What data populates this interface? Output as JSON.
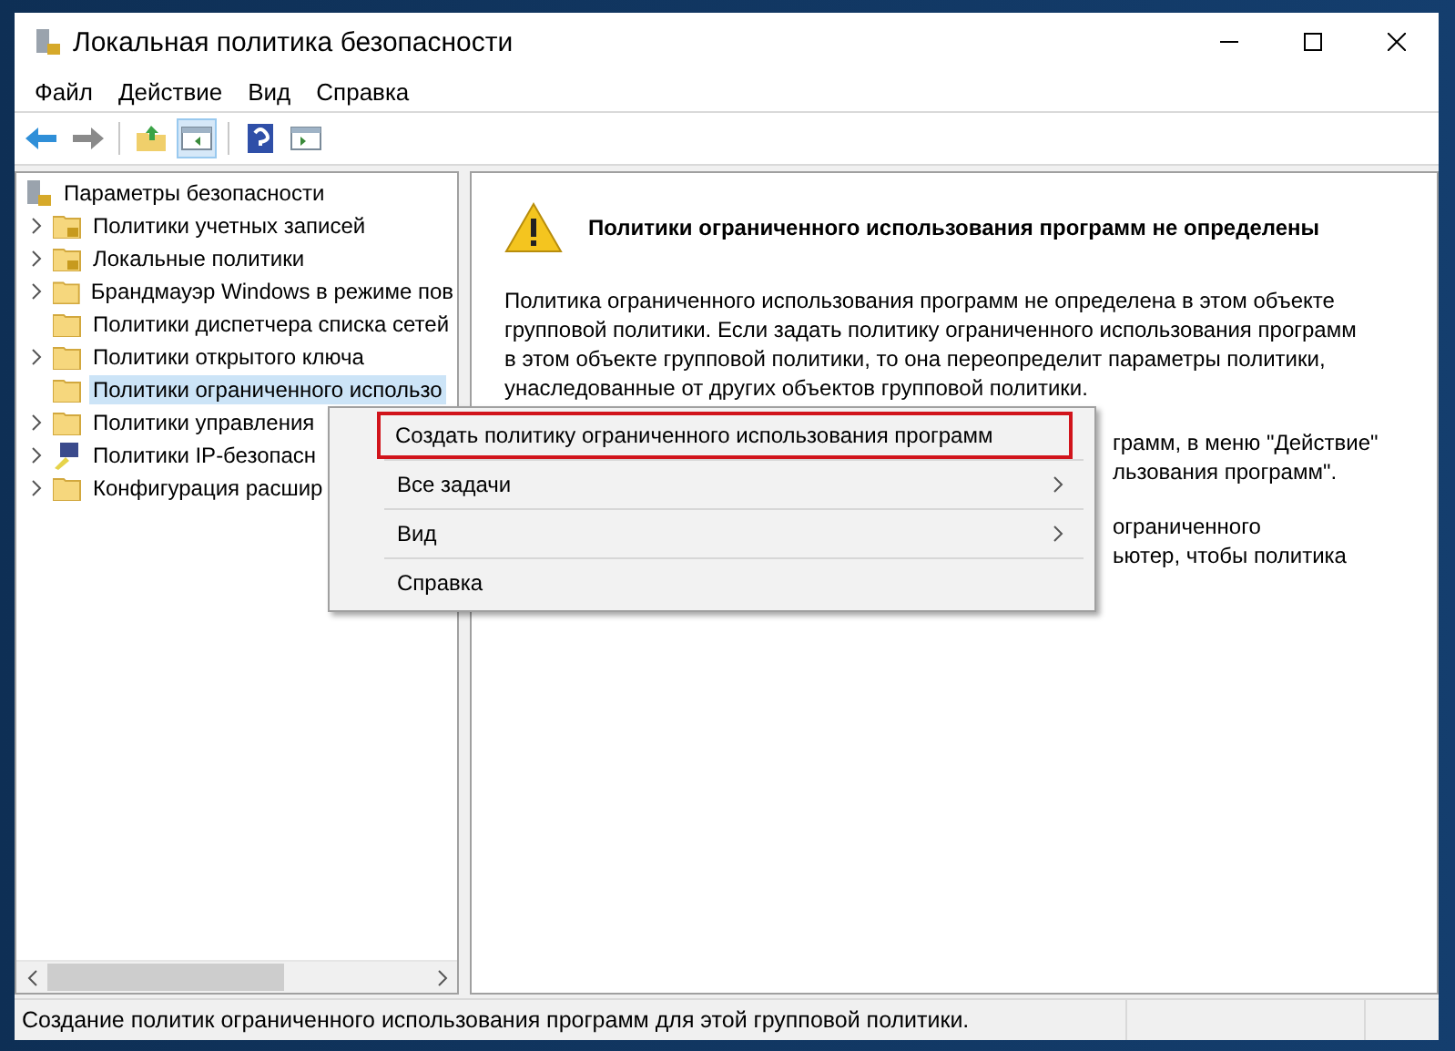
{
  "window": {
    "title": "Локальная политика безопасности"
  },
  "menu_bar": [
    "Файл",
    "Действие",
    "Вид",
    "Справка"
  ],
  "toolbar": [
    {
      "kind": "back",
      "disabled": false
    },
    {
      "kind": "forward",
      "disabled": true
    },
    {
      "kind": "separator"
    },
    {
      "kind": "up"
    },
    {
      "kind": "tree",
      "selected": true
    },
    {
      "kind": "separator"
    },
    {
      "kind": "help"
    },
    {
      "kind": "panel",
      "selected": false
    }
  ],
  "tree": {
    "root": {
      "label": "Параметры безопасности",
      "kind": "server"
    },
    "children": [
      {
        "label": "Политики учетных записей",
        "kind": "locked-folder",
        "expandable": true,
        "selected": false
      },
      {
        "label": "Локальные политики",
        "kind": "locked-folder",
        "expandable": true,
        "selected": false
      },
      {
        "label": "Брандмауэр Windows в режиме пов",
        "kind": "folder",
        "expandable": true,
        "selected": false
      },
      {
        "label": "Политики диспетчера списка сетей",
        "kind": "folder",
        "expandable": false,
        "selected": false
      },
      {
        "label": "Политики открытого ключа",
        "kind": "folder",
        "expandable": true,
        "selected": false
      },
      {
        "label": "Политики ограниченного использо",
        "kind": "folder",
        "expandable": false,
        "selected": true
      },
      {
        "label": "Политики управления",
        "kind": "folder",
        "expandable": true,
        "selected": false
      },
      {
        "label": "Политики IP-безопасн",
        "kind": "computer",
        "expandable": true,
        "selected": false
      },
      {
        "label": "Конфигурация расшир",
        "kind": "folder",
        "expandable": true,
        "selected": false
      }
    ]
  },
  "details": {
    "heading": "Политики ограниченного использования программ не определены",
    "paragraphs": [
      {
        "partly_covered": false,
        "lines": [
          "Политика ограниченного использования программ не определена в этом объекте",
          "групповой политики. Если задать политику ограниченного использования программ",
          "в этом объекте групповой политики, то она переопределит параметры политики,",
          "унаследованные от других объектов групповой политики."
        ]
      },
      {
        "partly_covered": true,
        "lines": [
          "грамм, в меню \"Действие\"",
          "льзования программ\"."
        ]
      },
      {
        "partly_covered": true,
        "lines": [
          "ограниченного",
          "ьютер, чтобы политика"
        ]
      }
    ]
  },
  "context_menu": [
    {
      "label": "Создать политику ограниченного использования программ",
      "outlined": true,
      "has_submenu": false
    },
    {
      "label": "Все задачи",
      "outlined": false,
      "has_submenu": true
    },
    {
      "label": "Вид",
      "outlined": false,
      "has_submenu": true
    },
    {
      "label": "Справка",
      "outlined": false,
      "has_submenu": false
    }
  ],
  "status_bar": "Создание политик ограниченного использования программ для этой групповой политики."
}
